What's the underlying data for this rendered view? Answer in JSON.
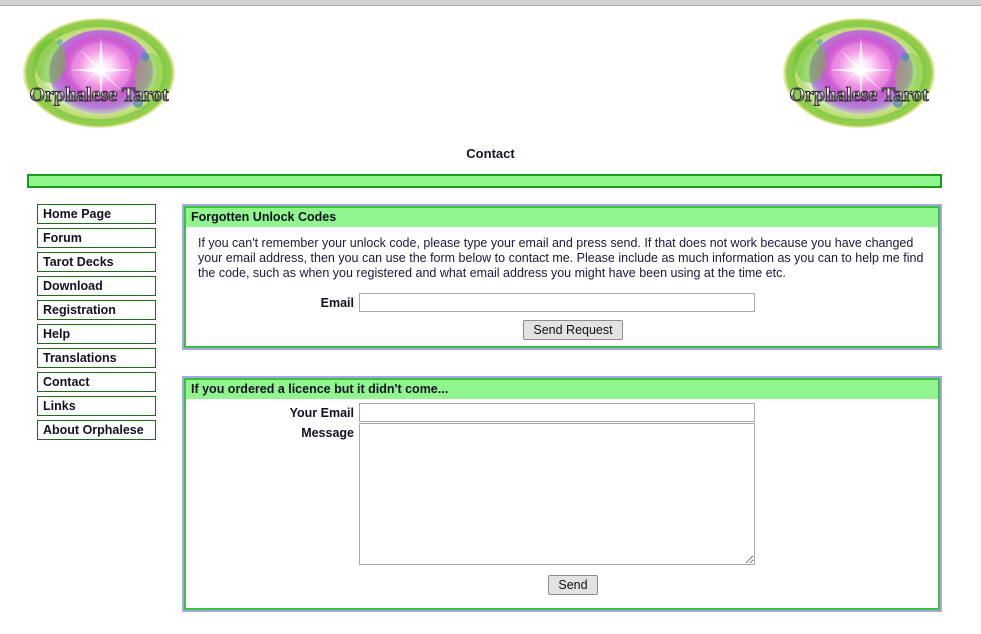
{
  "site": {
    "logo_text_main": "Orphalese",
    "logo_text_sub": "Tarot",
    "logo_alt": "orphalese-tarot-logo"
  },
  "page": {
    "title": "Contact"
  },
  "sidebar": {
    "items": [
      {
        "label": "Home Page",
        "name": "sidebar-item-home-page"
      },
      {
        "label": "Forum",
        "name": "sidebar-item-forum"
      },
      {
        "label": "Tarot Decks",
        "name": "sidebar-item-tarot-decks"
      },
      {
        "label": "Download",
        "name": "sidebar-item-download"
      },
      {
        "label": "Registration",
        "name": "sidebar-item-registration"
      },
      {
        "label": "Help",
        "name": "sidebar-item-help"
      },
      {
        "label": "Translations",
        "name": "sidebar-item-translations"
      },
      {
        "label": "Contact",
        "name": "sidebar-item-contact"
      },
      {
        "label": "Links",
        "name": "sidebar-item-links"
      },
      {
        "label": "About Orphalese",
        "name": "sidebar-item-about-orphalese"
      }
    ]
  },
  "panels": {
    "forgotten": {
      "header": "Forgotten Unlock Codes",
      "paragraph": "If you can't remember your unlock code, please type your email and press send. If that does not work because you have changed your email address, then you can use the form below to contact me. Please include as much information as you can to help me find the code, such as when you registered and what email address you might have been using at the time etc.",
      "email_label": "Email",
      "email_value": "",
      "email_placeholder": "",
      "submit_label": "Send Request"
    },
    "licence": {
      "header": "If you ordered a licence but it didn't come...",
      "email_label": "Your Email",
      "email_value": "",
      "email_placeholder": "",
      "message_label": "Message",
      "message_value": "",
      "message_placeholder": "",
      "submit_label": "Send"
    }
  },
  "colors": {
    "header_green": "#90f58f",
    "border_green": "#3ac23a",
    "nav_border_green": "#1d6b1d",
    "panel_outer_border": "#a6a6e8",
    "divider_border": "#14a014",
    "button_face": "#e2e2e2"
  }
}
